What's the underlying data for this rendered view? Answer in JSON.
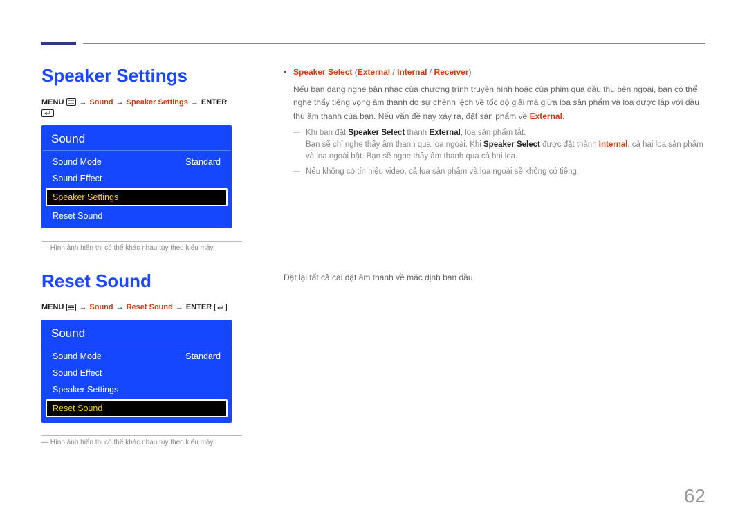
{
  "page_number": "62",
  "section1": {
    "title": "Speaker Settings",
    "breadcrumb": {
      "menu": "MENU",
      "p1": "Sound",
      "p2": "Speaker Settings",
      "enter": "ENTER"
    },
    "osd": {
      "header": "Sound",
      "items": [
        {
          "label": "Sound Mode",
          "value": "Standard",
          "selected": false
        },
        {
          "label": "Sound Effect",
          "value": "",
          "selected": false
        },
        {
          "label": "Speaker Settings",
          "value": "",
          "selected": true
        },
        {
          "label": "Reset Sound",
          "value": "",
          "selected": false
        }
      ]
    },
    "footnote": "Hình ảnh hiển thị có thể khác nhau tùy theo kiểu máy.",
    "right": {
      "line1_label": "Speaker Select",
      "line1_paren_open": " (",
      "line1_opt1": "External",
      "line1_sep": " / ",
      "line1_opt2": "Internal",
      "line1_opt3": "Receiver",
      "line1_paren_close": ")",
      "para1": "Nếu bạn đang nghe bản nhạc của chương trình truyền hình hoặc của phim qua đầu thu bên ngoài, bạn có thể nghe thấy tiếng vọng âm thanh do sự chênh lệch về tốc độ giải mã giữa loa sản phẩm và loa được lắp với đầu thu âm thanh của bạn. Nếu vấn đề này xảy ra, đặt sản phẩm về ",
      "para1_end": "External",
      "para1_dot": ".",
      "sub1_a": "Khi bạn đặt ",
      "sub1_b": "Speaker Select",
      "sub1_c": " thành ",
      "sub1_d": "External",
      "sub1_e": ", loa sản phẩm tắt.",
      "sub1_line2_a": "Bạn sẽ chỉ nghe thấy âm thanh qua loa ngoài. Khi ",
      "sub1_line2_b": "Speaker Select",
      "sub1_line2_c": " được đặt thành ",
      "sub1_line2_d": "Internal",
      "sub1_line2_e": ", cả hai loa sản phẩm và loa ngoài bật. Bạn sẽ nghe thấy âm thanh qua cả hai loa.",
      "sub2": "Nếu không có tín hiệu video, cả loa sản phẩm và loa ngoài sẽ không có tiếng."
    }
  },
  "section2": {
    "title": "Reset Sound",
    "breadcrumb": {
      "menu": "MENU",
      "p1": "Sound",
      "p2": "Reset Sound",
      "enter": "ENTER"
    },
    "osd": {
      "header": "Sound",
      "items": [
        {
          "label": "Sound Mode",
          "value": "Standard",
          "selected": false
        },
        {
          "label": "Sound Effect",
          "value": "",
          "selected": false
        },
        {
          "label": "Speaker Settings",
          "value": "",
          "selected": false
        },
        {
          "label": "Reset Sound",
          "value": "",
          "selected": true
        }
      ]
    },
    "footnote": "Hình ảnh hiển thị có thể khác nhau tùy theo kiểu máy.",
    "right": {
      "para": "Đặt lại tất cả cài đặt âm thanh về mặc định ban đầu."
    }
  }
}
